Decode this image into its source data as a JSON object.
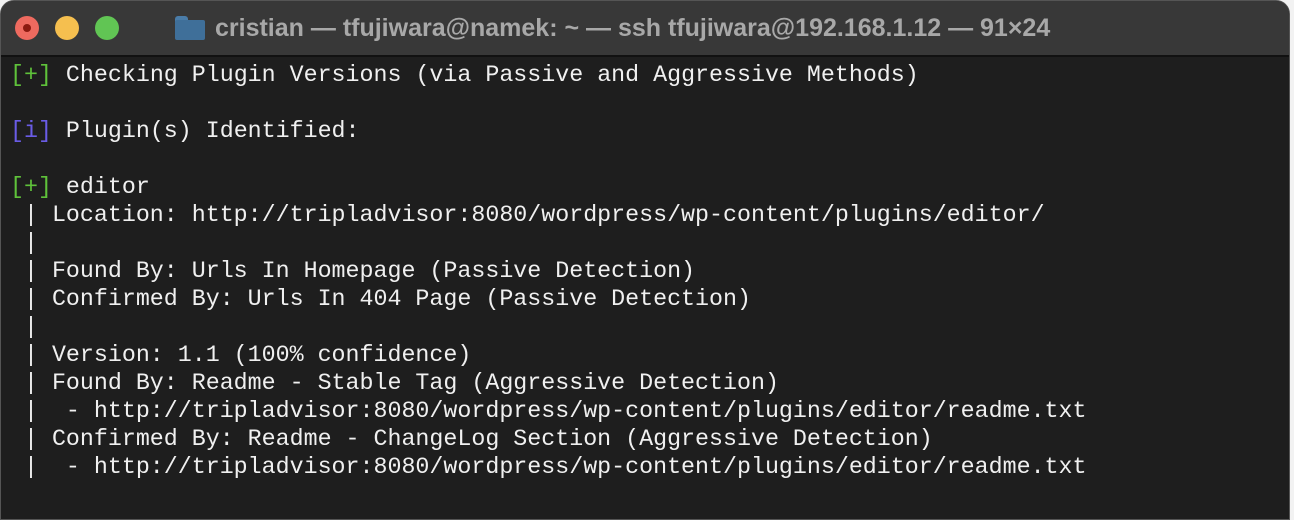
{
  "window": {
    "title": "cristian — tfujiwara@namek: ~ — ssh tfujiwara@192.168.1.12 — 91×24"
  },
  "colors": {
    "plus": "#5fc23a",
    "info": "#6a5ce6",
    "text": "#f0f0f0",
    "background": "#1e1e1e"
  },
  "lines": [
    {
      "prefix": "[+]",
      "type": "green",
      "text": " Checking Plugin Versions (via Passive and Aggressive Methods)"
    },
    {
      "prefix": "",
      "type": "",
      "text": ""
    },
    {
      "prefix": "[i]",
      "type": "purple",
      "text": " Plugin(s) Identified:"
    },
    {
      "prefix": "",
      "type": "",
      "text": ""
    },
    {
      "prefix": "[+]",
      "type": "green",
      "text": " editor"
    },
    {
      "prefix": "",
      "type": "",
      "text": " | Location: http://tripladvisor:8080/wordpress/wp-content/plugins/editor/"
    },
    {
      "prefix": "",
      "type": "",
      "text": " |"
    },
    {
      "prefix": "",
      "type": "",
      "text": " | Found By: Urls In Homepage (Passive Detection)"
    },
    {
      "prefix": "",
      "type": "",
      "text": " | Confirmed By: Urls In 404 Page (Passive Detection)"
    },
    {
      "prefix": "",
      "type": "",
      "text": " |"
    },
    {
      "prefix": "",
      "type": "",
      "text": " | Version: 1.1 (100% confidence)"
    },
    {
      "prefix": "",
      "type": "",
      "text": " | Found By: Readme - Stable Tag (Aggressive Detection)"
    },
    {
      "prefix": "",
      "type": "",
      "text": " |  - http://tripladvisor:8080/wordpress/wp-content/plugins/editor/readme.txt"
    },
    {
      "prefix": "",
      "type": "",
      "text": " | Confirmed By: Readme - ChangeLog Section (Aggressive Detection)"
    },
    {
      "prefix": "",
      "type": "",
      "text": " |  - http://tripladvisor:8080/wordpress/wp-content/plugins/editor/readme.txt"
    }
  ]
}
